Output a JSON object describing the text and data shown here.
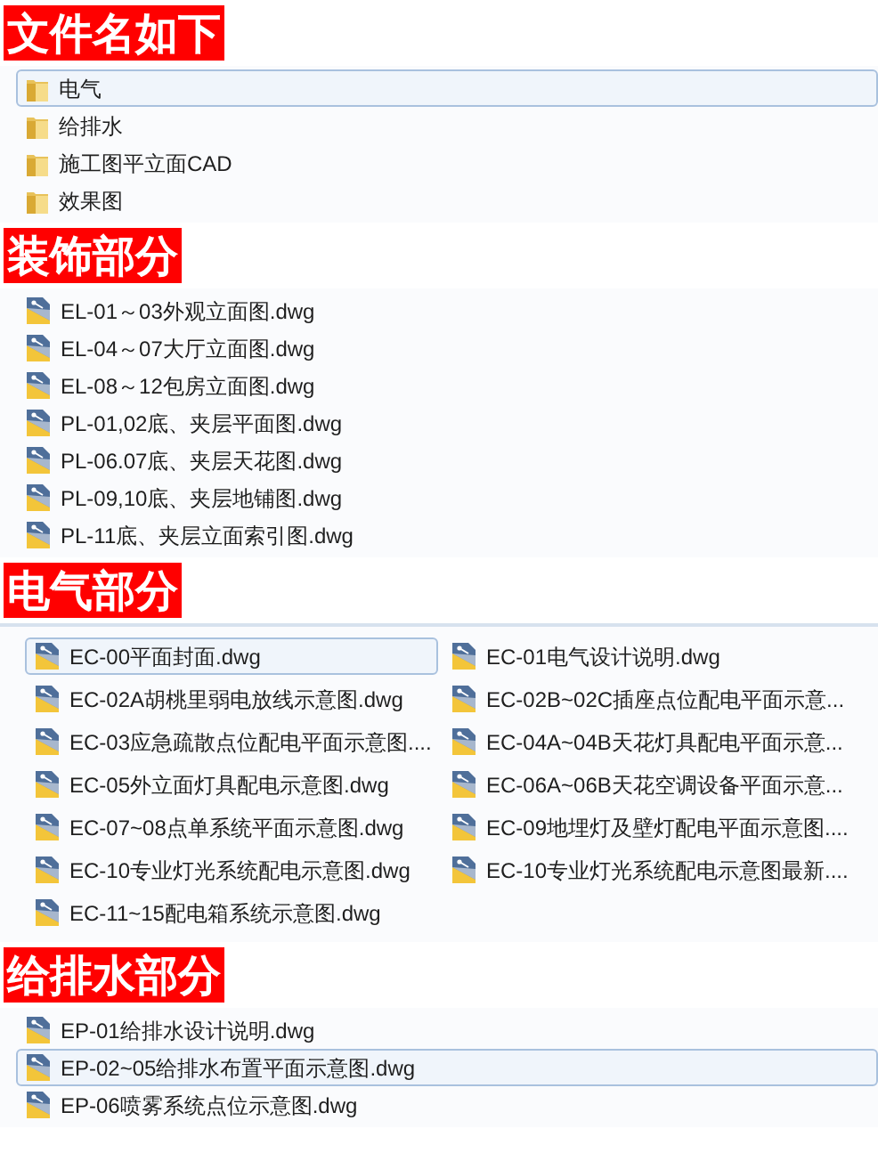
{
  "sections": [
    {
      "heading": "文件名如下",
      "kind": "list",
      "items": [
        {
          "kind": "folder",
          "name": "电气",
          "selected": true
        },
        {
          "kind": "folder",
          "name": "给排水",
          "selected": false
        },
        {
          "kind": "folder",
          "name": "施工图平立面CAD",
          "selected": false
        },
        {
          "kind": "folder",
          "name": "效果图",
          "selected": false
        }
      ]
    },
    {
      "heading": "装饰部分",
      "kind": "list",
      "items": [
        {
          "kind": "dwg",
          "name": "EL-01～03外观立面图.dwg",
          "selected": false
        },
        {
          "kind": "dwg",
          "name": "EL-04～07大厅立面图.dwg",
          "selected": false
        },
        {
          "kind": "dwg",
          "name": "EL-08～12包房立面图.dwg",
          "selected": false
        },
        {
          "kind": "dwg",
          "name": "PL-01,02底、夹层平面图.dwg",
          "selected": false
        },
        {
          "kind": "dwg",
          "name": "PL-06.07底、夹层天花图.dwg",
          "selected": false
        },
        {
          "kind": "dwg",
          "name": "PL-09,10底、夹层地铺图.dwg",
          "selected": false
        },
        {
          "kind": "dwg",
          "name": "PL-11底、夹层立面索引图.dwg",
          "selected": false
        }
      ]
    },
    {
      "heading": "电气部分",
      "kind": "grid",
      "items": [
        {
          "kind": "dwg",
          "name": "EC-00平面封面.dwg",
          "selected": true
        },
        {
          "kind": "dwg",
          "name": "EC-01电气设计说明.dwg",
          "selected": false
        },
        {
          "kind": "dwg",
          "name": "EC-02A胡桃里弱电放线示意图.dwg",
          "selected": false
        },
        {
          "kind": "dwg",
          "name": "EC-02B~02C插座点位配电平面示意...",
          "selected": false
        },
        {
          "kind": "dwg",
          "name": "EC-03应急疏散点位配电平面示意图....",
          "selected": false
        },
        {
          "kind": "dwg",
          "name": "EC-04A~04B天花灯具配电平面示意...",
          "selected": false
        },
        {
          "kind": "dwg",
          "name": "EC-05外立面灯具配电示意图.dwg",
          "selected": false
        },
        {
          "kind": "dwg",
          "name": "EC-06A~06B天花空调设备平面示意...",
          "selected": false
        },
        {
          "kind": "dwg",
          "name": "EC-07~08点单系统平面示意图.dwg",
          "selected": false
        },
        {
          "kind": "dwg",
          "name": "EC-09地埋灯及壁灯配电平面示意图....",
          "selected": false
        },
        {
          "kind": "dwg",
          "name": "EC-10专业灯光系统配电示意图.dwg",
          "selected": false
        },
        {
          "kind": "dwg",
          "name": "EC-10专业灯光系统配电示意图最新....",
          "selected": false
        },
        {
          "kind": "dwg",
          "name": "EC-11~15配电箱系统示意图.dwg",
          "selected": false
        }
      ]
    },
    {
      "heading": "给排水部分",
      "kind": "list",
      "items": [
        {
          "kind": "dwg",
          "name": "EP-01给排水设计说明.dwg",
          "selected": false
        },
        {
          "kind": "dwg",
          "name": "EP-02~05给排水布置平面示意图.dwg",
          "selected": true
        },
        {
          "kind": "dwg",
          "name": "EP-06喷雾系统点位示意图.dwg",
          "selected": false
        }
      ]
    }
  ]
}
